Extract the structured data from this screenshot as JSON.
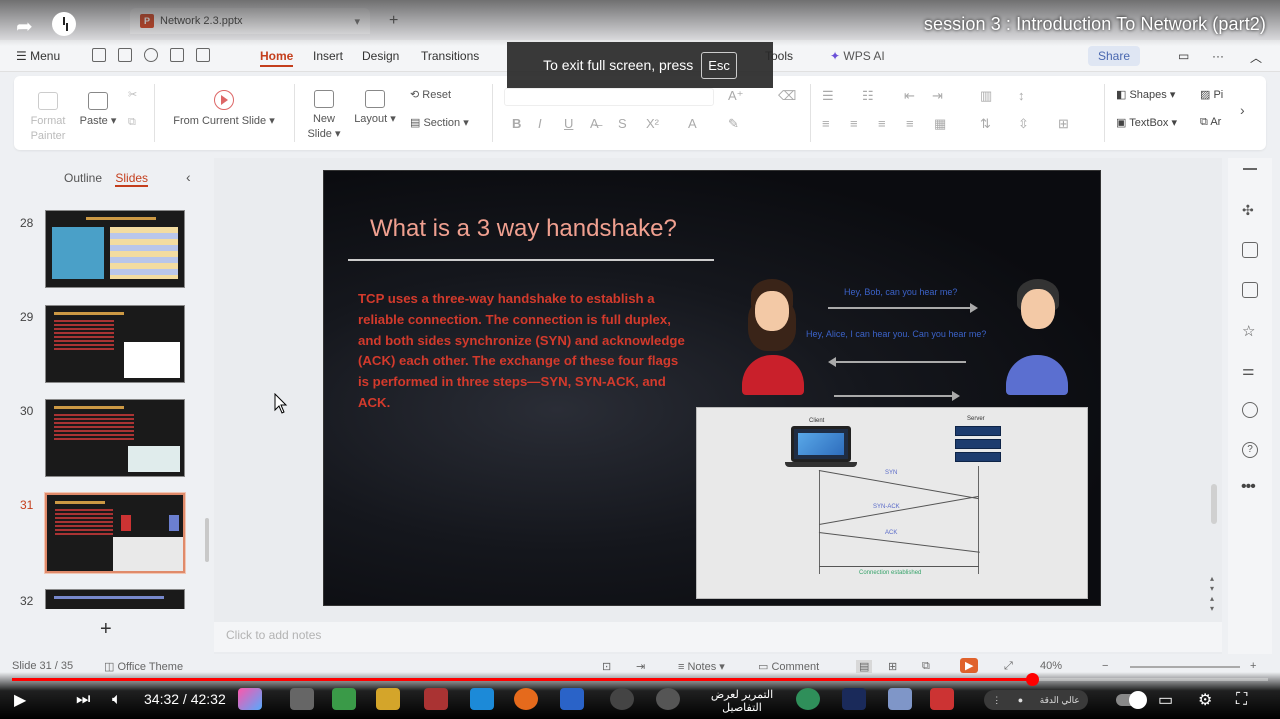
{
  "youtube": {
    "video_title": "session 3 : Introduction To Network (part2)",
    "time_current": "34:32",
    "time_total": "42:32",
    "progress_fraction": 0.812,
    "subtitle_ticker": "التمرير لعرض التفاصيل",
    "pill_label": "عالي الدقة"
  },
  "fullscreen_notice": {
    "text": "To exit full screen, press",
    "key": "Esc"
  },
  "wps": {
    "doc_tab": "Network 2.3.pptx",
    "menu_label": "Menu",
    "menu_tabs": [
      "Home",
      "Insert",
      "Design",
      "Transitions",
      "Tools"
    ],
    "active_tab": "Home",
    "wps_ai": "WPS AI",
    "share": "Share",
    "ribbon": {
      "format_painter": "Format Painter",
      "paste": "Paste",
      "from_current": "From Current Slide",
      "new_slide": "New Slide",
      "layout": "Layout",
      "reset": "Reset",
      "section": "Section",
      "shapes": "Shapes",
      "textbox": "TextBox",
      "picture_partial": "Pi",
      "arrange_partial": "Ar"
    },
    "pane": {
      "outline_tab": "Outline",
      "slides_tab": "Slides",
      "slide_numbers": [
        "28",
        "29",
        "30",
        "31",
        "32"
      ],
      "active_slide": "31"
    },
    "notes_placeholder": "Click to add notes",
    "status": {
      "slide_count": "Slide 31 / 35",
      "theme": "Office Theme",
      "notes": "Notes",
      "comment": "Comment",
      "zoom": "40%"
    }
  },
  "slide": {
    "title": "What is a 3 way handshake?",
    "body": "TCP uses a three-way handshake to establish a reliable connection. The connection is full duplex, and both sides synchronize (SYN) and acknowledge (ACK) each other. The exchange of these four flags is performed in three steps—SYN, SYN-ACK, and ACK.",
    "bubble_top": "Hey, Bob, can you hear me?",
    "bubble_mid": "Hey, Alice, I can hear you. Can you hear me?",
    "diagram": {
      "client": "Client",
      "server": "Server",
      "syn": "SYN",
      "syn_ack": "SYN-ACK",
      "ack": "ACK",
      "established": "Connection established"
    }
  },
  "colors": {
    "accent": "#c43e1c",
    "slide_text": "#d33a2c",
    "slide_title": "#f0a090",
    "progress": "#ff0000"
  }
}
